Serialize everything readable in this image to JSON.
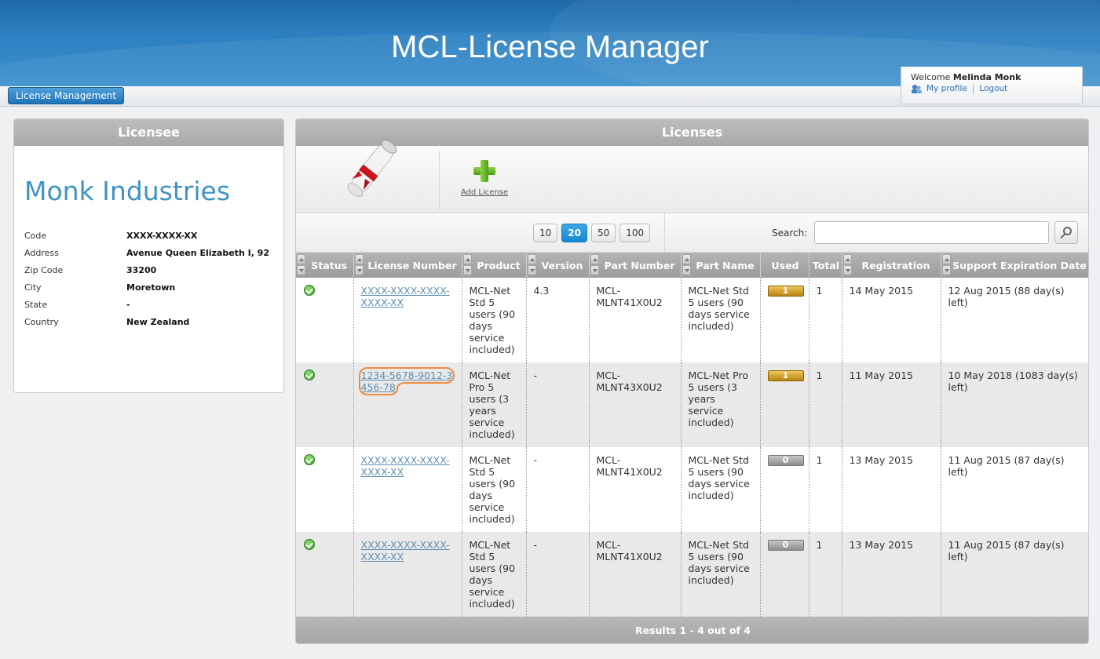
{
  "app": {
    "title": "MCL-License Manager"
  },
  "nav": {
    "license_management": "License Management"
  },
  "user": {
    "welcome": "Welcome",
    "name": "Melinda Monk",
    "my_profile": "My profile",
    "sep": "|",
    "logout": "Logout"
  },
  "licensee": {
    "header": "Licensee",
    "company": "Monk Industries",
    "fields": [
      {
        "label": "Code",
        "value": "XXXX-XXXX-XX"
      },
      {
        "label": "Address",
        "value": "Avenue Queen Elizabeth I, 92"
      },
      {
        "label": "Zip Code",
        "value": "33200"
      },
      {
        "label": "City",
        "value": "Moretown"
      },
      {
        "label": "State",
        "value": "-"
      },
      {
        "label": "Country",
        "value": "New Zealand"
      }
    ]
  },
  "licenses": {
    "header": "Licenses",
    "add_license": "Add License",
    "page_sizes": [
      "10",
      "20",
      "50",
      "100"
    ],
    "active_page_size": "20",
    "search_label": "Search:",
    "search_value": "",
    "columns": [
      "Status",
      "License Number",
      "Product",
      "Version",
      "Part Number",
      "Part Name",
      "Used",
      "Total",
      "Registration",
      "Support Expiration Date"
    ],
    "rows": [
      {
        "license": "XXXX-XXXX-XXXX-XXXX-XX",
        "product": "MCL-Net Std 5 users (90 days service included)",
        "version": "4.3",
        "part_number": "MCL-MLNT41X0U2",
        "part_name": "MCL-Net Std 5 users (90 days service included)",
        "used": "1",
        "total": "1",
        "registration": "14 May 2015",
        "expiration": "12 Aug 2015 (88 day(s) left)"
      },
      {
        "license": "1234-5678-9012-3456-78",
        "product": "MCL-Net Pro 5 users (3 years service included)",
        "version": "-",
        "part_number": "MCL-MLNT43X0U2",
        "part_name": "MCL-Net Pro 5 users (3 years service included)",
        "used": "1",
        "total": "1",
        "registration": "11 May 2015",
        "expiration": "10 May 2018 (1083 day(s) left)"
      },
      {
        "license": "XXXX-XXXX-XXXX-XXXX-XX",
        "product": "MCL-Net Std 5 users (90 days service included)",
        "version": "-",
        "part_number": "MCL-MLNT41X0U2",
        "part_name": "MCL-Net Std 5 users (90 days service included)",
        "used": "0",
        "total": "1",
        "registration": "13 May 2015",
        "expiration": "11 Aug 2015 (87 day(s) left)"
      },
      {
        "license": "XXXX-XXXX-XXXX-XXXX-XX",
        "product": "MCL-Net Std 5 users (90 days service included)",
        "version": "-",
        "part_number": "MCL-MLNT41X0U2",
        "part_name": "MCL-Net Std 5 users (90 days service included)",
        "used": "0",
        "total": "1",
        "registration": "13 May 2015",
        "expiration": "11 Aug 2015 (87 day(s) left)"
      }
    ],
    "results": "Results 1 - 4 out of 4"
  },
  "colors": {
    "header_blue": "#2c7fc0",
    "company_blue": "#3f94c2",
    "used_gold": "#c8951f",
    "status_green": "#3c9d2a",
    "highlight_orange": "#f08a3c"
  },
  "icons": [
    "status-ok-icon",
    "search-icon",
    "add-license-plus-icon",
    "license-scroll-icon",
    "profile-icon"
  ]
}
